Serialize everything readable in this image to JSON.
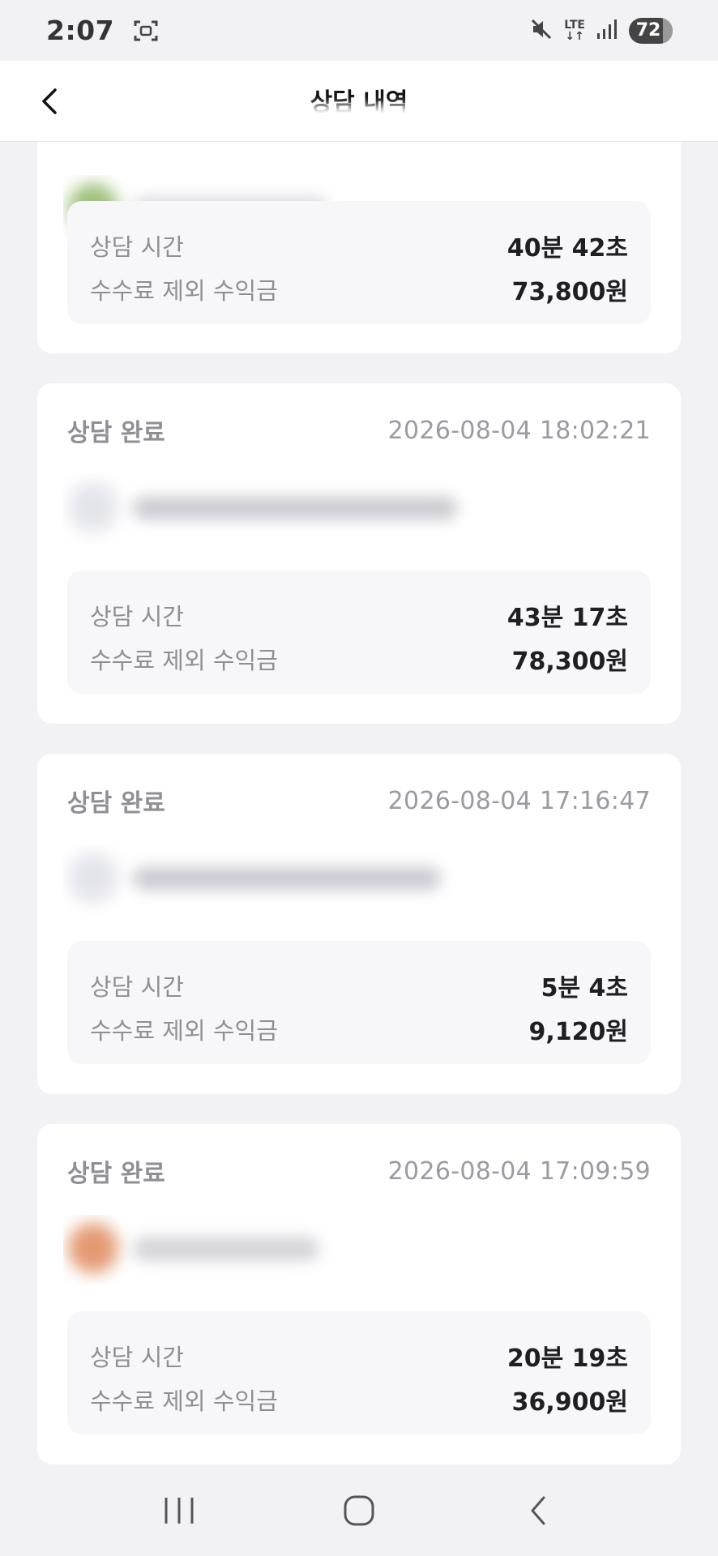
{
  "status_bar": {
    "time": "2:07",
    "network": "LTE",
    "battery": "72"
  },
  "header": {
    "title": "상담 내역"
  },
  "top_card": {
    "time_label": "상담 시간",
    "time_value": "40분 42초",
    "earnings_label": "수수료 제외 수익금",
    "earnings_value": "73,800원"
  },
  "cards": [
    {
      "status": "상담 완료",
      "date": "2026-08-04 18:02:21",
      "time_label": "상담 시간",
      "time_value": "43분 17초",
      "earnings_label": "수수료 제외 수익금",
      "earnings_value": "78,300원"
    },
    {
      "status": "상담 완료",
      "date": "2026-08-04 17:16:47",
      "time_label": "상담 시간",
      "time_value": "5분 4초",
      "earnings_label": "수수료 제외 수익금",
      "earnings_value": "9,120원"
    },
    {
      "status": "상담 완료",
      "date": "2026-08-04 17:09:59",
      "time_label": "상담 시간",
      "time_value": "20분 19초",
      "earnings_label": "수수료 제외 수익금",
      "earnings_value": "36,900원"
    }
  ],
  "icons": {
    "back": "chevron-left-icon",
    "nav_recent": "recent-apps-icon",
    "nav_home": "home-icon",
    "nav_back": "back-icon"
  },
  "colors": {
    "background": "#f2f2f6",
    "card": "#ffffff",
    "stats_box": "#f7f7fa",
    "muted_text": "#8e8e96"
  }
}
